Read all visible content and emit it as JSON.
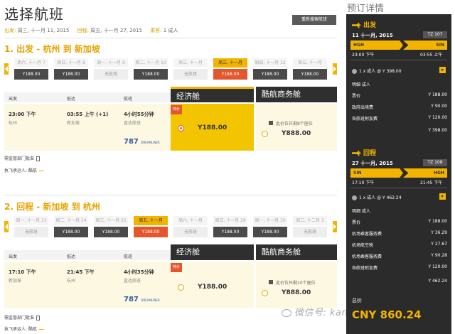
{
  "page_title": "选择航班",
  "trip_info": {
    "depart_label": "出发:",
    "depart_value": "周三, 十一月 11, 2015",
    "return_label": "回程:",
    "return_value": "周五, 十一月 27, 2015",
    "pax_label": "乘客:",
    "pax_value": "1 成人"
  },
  "research_button": "重新搜索航班",
  "outbound": {
    "heading": "1. 出发 - 杭州 到 新加坡",
    "days": [
      {
        "date": "周六, 十一月 7",
        "price": "Y188.00",
        "state": "normal"
      },
      {
        "date": "周日, 十一月 8",
        "price": "Y188.00",
        "state": "normal"
      },
      {
        "date": "周一, 十一月 9",
        "price": "无航班",
        "state": "na"
      },
      {
        "date": "周二, 十一月 10",
        "price": "Y188.00",
        "state": "normal"
      },
      {
        "date": "周三, 十一月",
        "price": "无航班",
        "state": "na"
      },
      {
        "date": "周三, 十一月",
        "price": "Y188.00",
        "state": "sel"
      },
      {
        "date": "周四, 十一月 12",
        "price": "Y188.00",
        "state": "normal"
      },
      {
        "date": "周五, 十一月",
        "price": "Y188.00",
        "state": "normal"
      }
    ],
    "cols": {
      "depart": "出发",
      "arrive": "抵达",
      "flight": "航班"
    },
    "eco_label": "经济舱",
    "biz_label": "酷航商务舱",
    "dep_time": "23:00 下午",
    "dep_city": "杭州",
    "arr_time": "03:55 上午 (+1)",
    "arr_city": "新加坡",
    "duration": "4小时55分钟",
    "direct": "直达航班",
    "aircraft": "787",
    "aircraft_sub": "DREAMLINER",
    "promo_tag": "特价",
    "eco_price": "Y188.00",
    "biz_seats": "此价位只剩8个座位",
    "biz_price": "Y888.00",
    "foot1": "需监管部门批准",
    "foot2": "执飞承运人: 酷航"
  },
  "inbound": {
    "heading": "2. 回程 - 新加坡 到 杭州",
    "days": [
      {
        "date": "周一, 十一月 23",
        "price": "无航班",
        "state": "na"
      },
      {
        "date": "周二, 十一月 24",
        "price": "Y188.00",
        "state": "normal"
      },
      {
        "date": "周三, 十一月 25",
        "price": "Y188.00",
        "state": "normal"
      },
      {
        "date": "周五, 十一月",
        "price": "Y188.00",
        "state": "sel"
      },
      {
        "date": "周六, 十一月",
        "price": "无航班",
        "state": "na"
      },
      {
        "date": "周日, 十一月 29",
        "price": "Y188.00",
        "state": "normal"
      },
      {
        "date": "周一, 十一月 30",
        "price": "Y188.00",
        "state": "normal"
      },
      {
        "date": "周二, 十二月 1",
        "price": "无航班",
        "state": "na"
      }
    ],
    "cols": {
      "depart": "出发",
      "arrive": "抵达",
      "flight": "航班"
    },
    "eco_label": "经济舱",
    "biz_label": "酷航商务舱",
    "dep_time": "17:10 下午",
    "dep_city": "新加坡",
    "arr_time": "21:45 下午",
    "arr_city": "杭州",
    "duration": "4小时35分钟",
    "direct": "直达航班",
    "aircraft": "787",
    "aircraft_sub": "DREAMLINER",
    "promo_tag": "特价",
    "eco_price": "Y188.00",
    "biz_seats": "此价位只剩10个座位",
    "biz_price": "Y888.00",
    "foot1": "需监管部门批准",
    "foot2": "执飞承运人: 酷航"
  },
  "sidebar": {
    "title": "预订详情",
    "out": {
      "label": "出发",
      "date": "11 十一月, 2015",
      "flight": "TZ 107",
      "from": "HGH",
      "to": "SIN",
      "dep": "23:00 下午",
      "arr": "03:55 上午",
      "pax": "1 x 成人 @ Y 398.00",
      "rows": [
        {
          "k": "明细 成人",
          "v": ""
        },
        {
          "k": "票价",
          "v": "Y 188.00"
        },
        {
          "k": "政府出境费",
          "v": "Y 90.00"
        },
        {
          "k": "各航班附加费",
          "v": "Y 120.00"
        },
        {
          "k": "",
          "v": "Y 398.00"
        }
      ]
    },
    "ret": {
      "label": "回程",
      "date": "27 十一月, 2015",
      "flight": "TZ 108",
      "from": "SIN",
      "to": "HGH",
      "dep": "17:10 下午",
      "arr": "21:45 下午",
      "pax": "1 x 成人 @ Y 462.24",
      "rows": [
        {
          "k": "明细 成人",
          "v": ""
        },
        {
          "k": "票价",
          "v": "Y 188.00"
        },
        {
          "k": "机场乘客服务费",
          "v": "Y 36.29"
        },
        {
          "k": "机场航空税",
          "v": "Y 27.67"
        },
        {
          "k": "机场乘客服务费",
          "v": "Y 90.28"
        },
        {
          "k": "各航班附加费",
          "v": "Y 120.00"
        },
        {
          "k": "",
          "v": "Y 462.24"
        }
      ]
    },
    "total_label": "总价",
    "total_amount": "CNY 860.24"
  },
  "watermark": "微信号: kanxinjiapo",
  "colors": {
    "accent": "#f3b400",
    "selected": "#e4572e",
    "dark": "#2b2b2b"
  }
}
